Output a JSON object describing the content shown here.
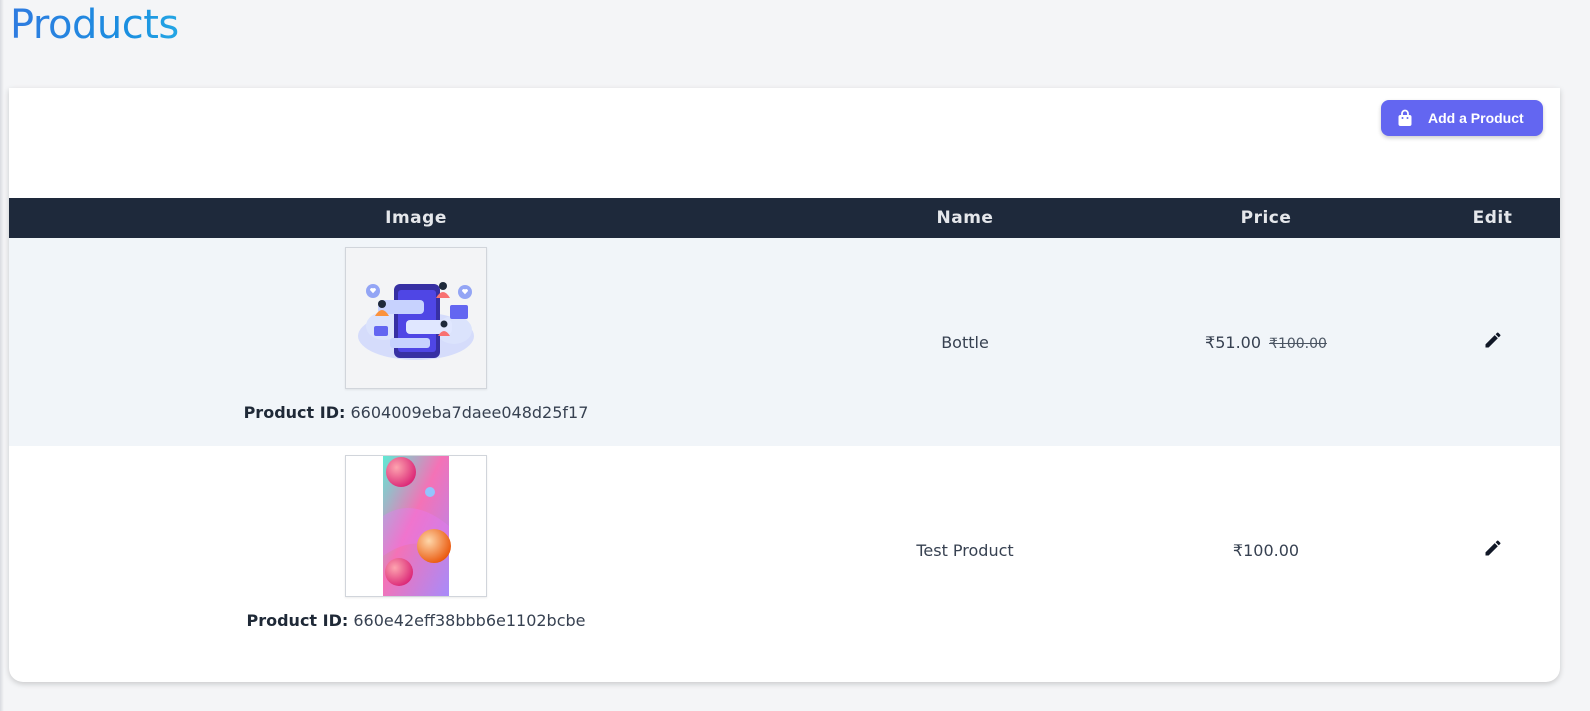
{
  "page": {
    "title": "Products"
  },
  "toolbar": {
    "add_label": "Add a Product"
  },
  "table": {
    "headers": {
      "image": "Image",
      "name": "Name",
      "price": "Price",
      "edit": "Edit"
    },
    "rows": [
      {
        "id_label": "Product ID:",
        "id": "6604009eba7daee048d25f17",
        "name": "Bottle",
        "price": "₹51.00",
        "original_price": "₹100.00",
        "image_icon": "chat-illustration-icon"
      },
      {
        "id_label": "Product ID:",
        "id": "660e42eff38bbb6e1102bcbe",
        "name": "Test Product",
        "price": "₹100.00",
        "original_price": "",
        "image_icon": "gradient-spheres-icon"
      }
    ]
  },
  "colors": {
    "accent": "#6366f1",
    "header_bg": "#1e293b",
    "title_blue": "#1a8fe0",
    "row_shaded": "#f1f5f9"
  }
}
